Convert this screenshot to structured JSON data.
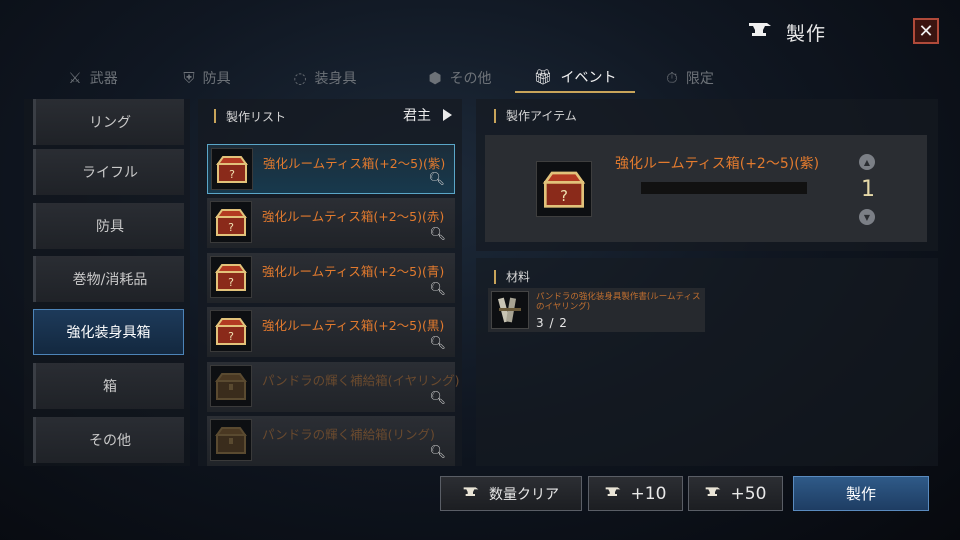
{
  "header": {
    "title": "製作",
    "close_symbol": "✕"
  },
  "tabs": [
    {
      "label": "武器",
      "icon": "crossed-swords-icon",
      "active": false
    },
    {
      "label": "防具",
      "icon": "shield-icon",
      "active": false
    },
    {
      "label": "装身具",
      "icon": "necklace-icon",
      "active": false
    },
    {
      "label": "その他",
      "icon": "cube-icon",
      "active": false
    },
    {
      "label": "イベント",
      "icon": "gift-icon",
      "active": true
    },
    {
      "label": "限定",
      "icon": "timer-icon",
      "active": false
    }
  ],
  "categories": [
    {
      "label": "リング",
      "active": false
    },
    {
      "label": "ライフル",
      "active": false
    },
    {
      "label": "防具",
      "active": false
    },
    {
      "label": "巻物/消耗品",
      "active": false
    },
    {
      "label": "強化装身具箱",
      "active": true
    },
    {
      "label": "箱",
      "active": false
    },
    {
      "label": "その他",
      "active": false
    }
  ],
  "craft_list": {
    "header": "製作リスト",
    "filter": "君主",
    "items": [
      {
        "name": "強化ルームティス箱(+2〜5)(紫)",
        "icon": "red-chest-icon",
        "active": true,
        "dim": false
      },
      {
        "name": "強化ルームティス箱(+2〜5)(赤)",
        "icon": "red-chest-icon",
        "active": false,
        "dim": false
      },
      {
        "name": "強化ルームティス箱(+2〜5)(青)",
        "icon": "red-chest-icon",
        "active": false,
        "dim": false
      },
      {
        "name": "強化ルームティス箱(+2〜5)(黒)",
        "icon": "red-chest-icon",
        "active": false,
        "dim": false
      },
      {
        "name": "パンドラの輝く補給箱(イヤリング)",
        "icon": "wooden-chest-icon",
        "active": false,
        "dim": true
      },
      {
        "name": "パンドラの輝く補給箱(リング)",
        "icon": "wooden-chest-icon",
        "active": false,
        "dim": true
      }
    ]
  },
  "craft_item": {
    "header": "製作アイテム",
    "name": "強化ルームティス箱(+2〜5)(紫)",
    "quantity": "1"
  },
  "materials": {
    "header": "材料",
    "items": [
      {
        "name": "パンドラの強化装身具製作書(ルームティスのイヤリング)",
        "count": "3 / 2",
        "icon": "scroll-bundle-icon"
      }
    ]
  },
  "buttons": {
    "clear": "数量クリア",
    "plus10": "+10",
    "plus50": "+50",
    "craft": "製作"
  },
  "colors": {
    "accent_gold": "#c8a45a",
    "item_orange": "#e27a2e",
    "craft_blue": "#2f5a88"
  }
}
